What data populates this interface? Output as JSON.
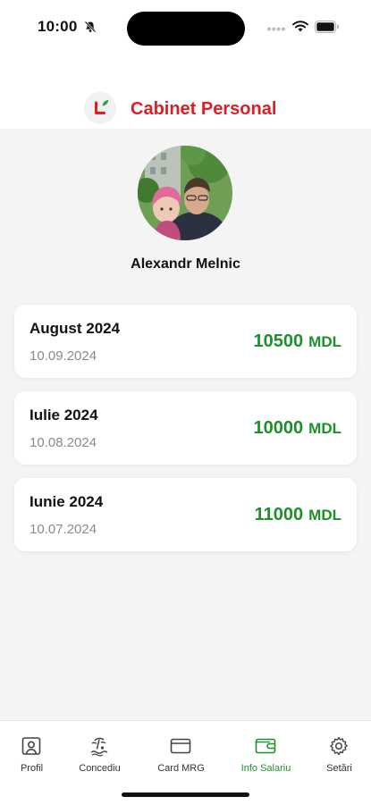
{
  "status": {
    "time": "10:00"
  },
  "header": {
    "title": "Cabinet Personal"
  },
  "profile": {
    "name": "Alexandr Melnic"
  },
  "salaries": [
    {
      "month": "August 2024",
      "date": "10.09.2024",
      "amount": "10500",
      "currency": "MDL"
    },
    {
      "month": "Iulie 2024",
      "date": "10.08.2024",
      "amount": "10000",
      "currency": "MDL"
    },
    {
      "month": "Iunie 2024",
      "date": "10.07.2024",
      "amount": "11000",
      "currency": "MDL"
    }
  ],
  "tabs": [
    {
      "label": "Profil",
      "icon": "profile-icon"
    },
    {
      "label": "Concediu",
      "icon": "beach-icon"
    },
    {
      "label": "Card MRG",
      "icon": "card-icon"
    },
    {
      "label": "Info Salariu",
      "icon": "wallet-icon",
      "active": true
    },
    {
      "label": "Setări",
      "icon": "gear-icon"
    }
  ],
  "colors": {
    "brand_red": "#e01d24",
    "accent_green": "#1e8e2e",
    "background": "#f4f4f4"
  }
}
